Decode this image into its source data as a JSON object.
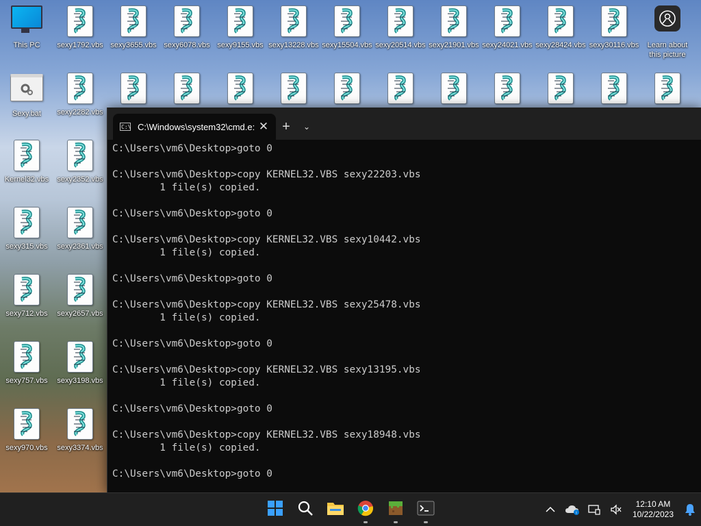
{
  "desktop": {
    "icons_row1": [
      {
        "label": "This PC",
        "type": "pc"
      },
      {
        "label": "sexy1792.vbs",
        "type": "vbs"
      },
      {
        "label": "sexy3655.vbs",
        "type": "vbs"
      },
      {
        "label": "sexy6078.vbs",
        "type": "vbs"
      },
      {
        "label": "sexy9155.vbs",
        "type": "vbs"
      },
      {
        "label": "sexy13228.vbs",
        "type": "vbs"
      },
      {
        "label": "sexy15504.vbs",
        "type": "vbs"
      },
      {
        "label": "sexy20514.vbs",
        "type": "vbs"
      },
      {
        "label": "sexy21901.vbs",
        "type": "vbs"
      },
      {
        "label": "sexy24021.vbs",
        "type": "vbs"
      },
      {
        "label": "sexy28424.vbs",
        "type": "vbs"
      },
      {
        "label": "sexy30116.vbs",
        "type": "vbs"
      },
      {
        "label": "Learn about this picture",
        "type": "learn"
      }
    ],
    "icons_col1": [
      {
        "label": "Sexy.bat",
        "type": "bat"
      },
      {
        "label": "Kernel32.vbs",
        "type": "vbs"
      },
      {
        "label": "sexy315.vbs",
        "type": "vbs"
      },
      {
        "label": "sexy712.vbs",
        "type": "vbs"
      },
      {
        "label": "sexy757.vbs",
        "type": "vbs"
      },
      {
        "label": "sexy970.vbs",
        "type": "vbs"
      }
    ],
    "icons_col2": [
      {
        "label": "sexy2282.vbs",
        "type": "vbs"
      },
      {
        "label": "sexy2352.vbs",
        "type": "vbs"
      },
      {
        "label": "sexy2361.vbs",
        "type": "vbs"
      },
      {
        "label": "sexy2657.vbs",
        "type": "vbs"
      },
      {
        "label": "sexy3198.vbs",
        "type": "vbs"
      },
      {
        "label": "sexy3374.vbs",
        "type": "vbs"
      }
    ]
  },
  "terminal": {
    "tab_title": "C:\\Windows\\system32\\cmd.e:",
    "close_glyph": "✕",
    "new_tab_glyph": "+",
    "dropdown_glyph": "⌄",
    "lines": [
      "C:\\Users\\vm6\\Desktop>goto 0",
      "",
      "C:\\Users\\vm6\\Desktop>copy KERNEL32.VBS sexy22203.vbs",
      "        1 file(s) copied.",
      "",
      "C:\\Users\\vm6\\Desktop>goto 0",
      "",
      "C:\\Users\\vm6\\Desktop>copy KERNEL32.VBS sexy10442.vbs",
      "        1 file(s) copied.",
      "",
      "C:\\Users\\vm6\\Desktop>goto 0",
      "",
      "C:\\Users\\vm6\\Desktop>copy KERNEL32.VBS sexy25478.vbs",
      "        1 file(s) copied.",
      "",
      "C:\\Users\\vm6\\Desktop>goto 0",
      "",
      "C:\\Users\\vm6\\Desktop>copy KERNEL32.VBS sexy13195.vbs",
      "        1 file(s) copied.",
      "",
      "C:\\Users\\vm6\\Desktop>goto 0",
      "",
      "C:\\Users\\vm6\\Desktop>copy KERNEL32.VBS sexy18948.vbs",
      "        1 file(s) copied.",
      "",
      "C:\\Users\\vm6\\Desktop>goto 0"
    ]
  },
  "taskbar": {
    "apps": [
      {
        "name": "start-button",
        "icon": "windows-logo-icon",
        "running": false
      },
      {
        "name": "search-button",
        "icon": "search-icon",
        "running": false
      },
      {
        "name": "file-explorer-button",
        "icon": "folder-icon",
        "running": false
      },
      {
        "name": "chrome-button",
        "icon": "chrome-icon",
        "running": true
      },
      {
        "name": "minecraft-button",
        "icon": "grass-block-icon",
        "running": true
      },
      {
        "name": "terminal-button",
        "icon": "terminal-icon",
        "running": true
      }
    ],
    "time": "12:10 AM",
    "date": "10/22/2023"
  },
  "colors": {
    "terminal_bg": "#0c0c0c",
    "terminal_text": "#cccccc",
    "tabbar_bg": "#202020",
    "taskbar_bg": "#202020",
    "accent": "#0078d4"
  }
}
